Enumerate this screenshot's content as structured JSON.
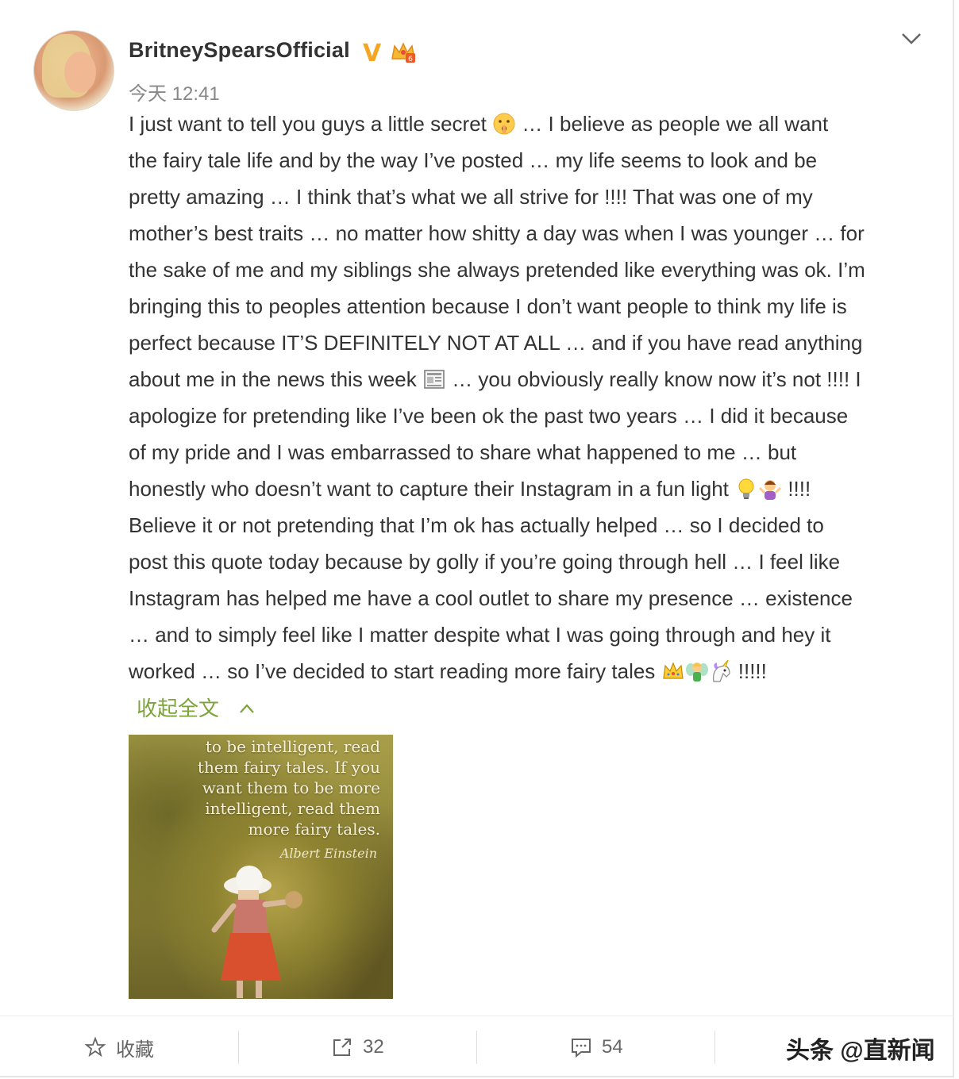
{
  "post": {
    "author": "BritneySpearsOfficial",
    "verified_badge": "V",
    "time": "今天 12:41",
    "lines": [
      [
        "I just want to tell you guys a little secret ",
        "emoji:shush-face",
        " … I believe as people we all want"
      ],
      [
        "the fairy tale life and by the way I’ve posted … my life seems to look and be"
      ],
      [
        "pretty amazing … I think that’s what we all strive for !!!! That was one of my"
      ],
      [
        "mother’s best traits … no matter how shitty a day was when I was younger … for"
      ],
      [
        "the sake of me and my siblings she always pretended like everything was ok. I’m"
      ],
      [
        "bringing this to peoples attention because I don’t want people to think my life is"
      ],
      [
        "perfect because IT’S DEFINITELY NOT AT ALL … and if you have read anything"
      ],
      [
        "about me in the news this week ",
        "emoji:newspaper",
        " … you obviously really know now it’s not !!!! I"
      ],
      [
        "apologize for pretending like I’ve been ok the past two years … I did it because"
      ],
      [
        "of my pride and I was embarrassed to share what happened to me … but"
      ],
      [
        "honestly who doesn’t want to capture their Instagram in a fun light ",
        "emoji:light-bulb",
        "emoji:shrug-woman",
        " !!!!"
      ],
      [
        "Believe it or not pretending that I’m ok has actually helped … so I decided to"
      ],
      [
        "post this quote today because by golly if you’re going through hell … I feel like"
      ],
      [
        "Instagram has helped me have a cool outlet to share my presence … existence"
      ],
      [
        "… and to simply feel like I matter despite what I was going through and hey it"
      ],
      [
        "worked … so I’ve decided to start reading more fairy tales ",
        "emoji:crown",
        "emoji:fairy",
        "emoji:unicorn",
        " !!!!!"
      ]
    ],
    "collapse_label": "收起全文",
    "image": {
      "quote_lines": [
        "to be intelligent, read",
        "them fairy tales. If you",
        "want them to be more",
        "intelligent, read them",
        "more fairy tales."
      ],
      "signature": "Albert Einstein"
    }
  },
  "actions": {
    "favorite_label": "收藏",
    "repost_count": "32",
    "comment_count": "54"
  },
  "watermark": "头条 @直新闻",
  "colors": {
    "accent_green": "#7da33a",
    "verified_orange": "#f5a623",
    "text": "#333333",
    "muted": "#888888"
  }
}
